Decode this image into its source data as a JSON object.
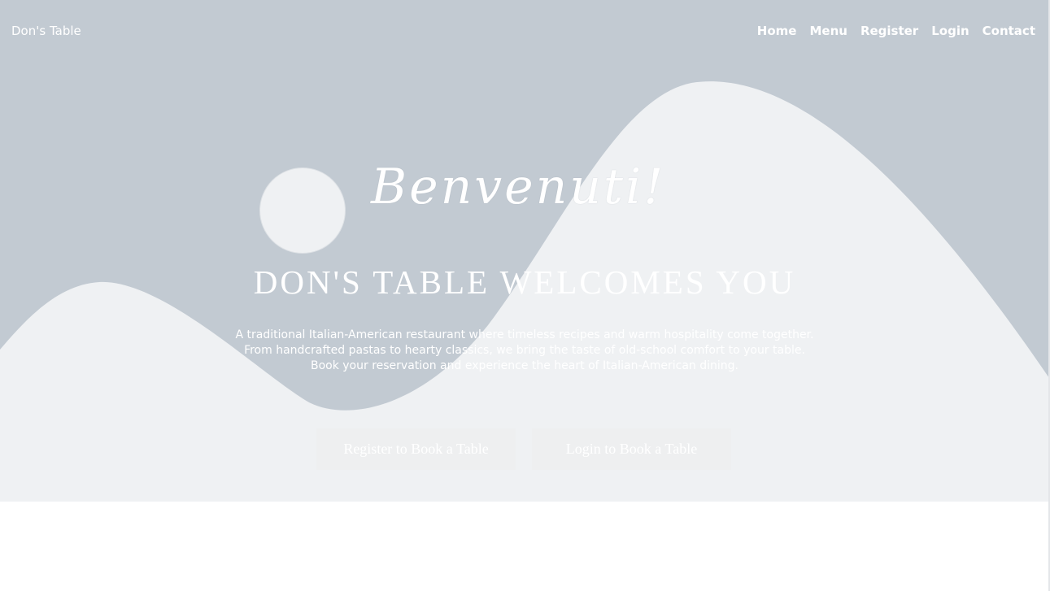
{
  "header": {
    "brand": "Don's Table",
    "nav": [
      "Home",
      "Menu",
      "Register",
      "Login",
      "Contact"
    ]
  },
  "hero": {
    "script_title": "Benvenuti!",
    "headline": "DON'S TABLE WELCOMES YOU",
    "description_lines": [
      "A traditional Italian-American restaurant where timeless recipes and warm hospitality come together.",
      "From handcrafted pastas to hearty classics, we bring the taste of old-school comfort to your table.",
      "Book your reservation and experience the heart of Italian-American dining."
    ],
    "buttons": {
      "register": "Register to Book a Table",
      "login": "Login to Book a Table"
    }
  },
  "colors": {
    "sky": "#c2cad2",
    "hills": "#eff1f3",
    "text": "#ffffff",
    "button_bg": "#eeeff0"
  }
}
